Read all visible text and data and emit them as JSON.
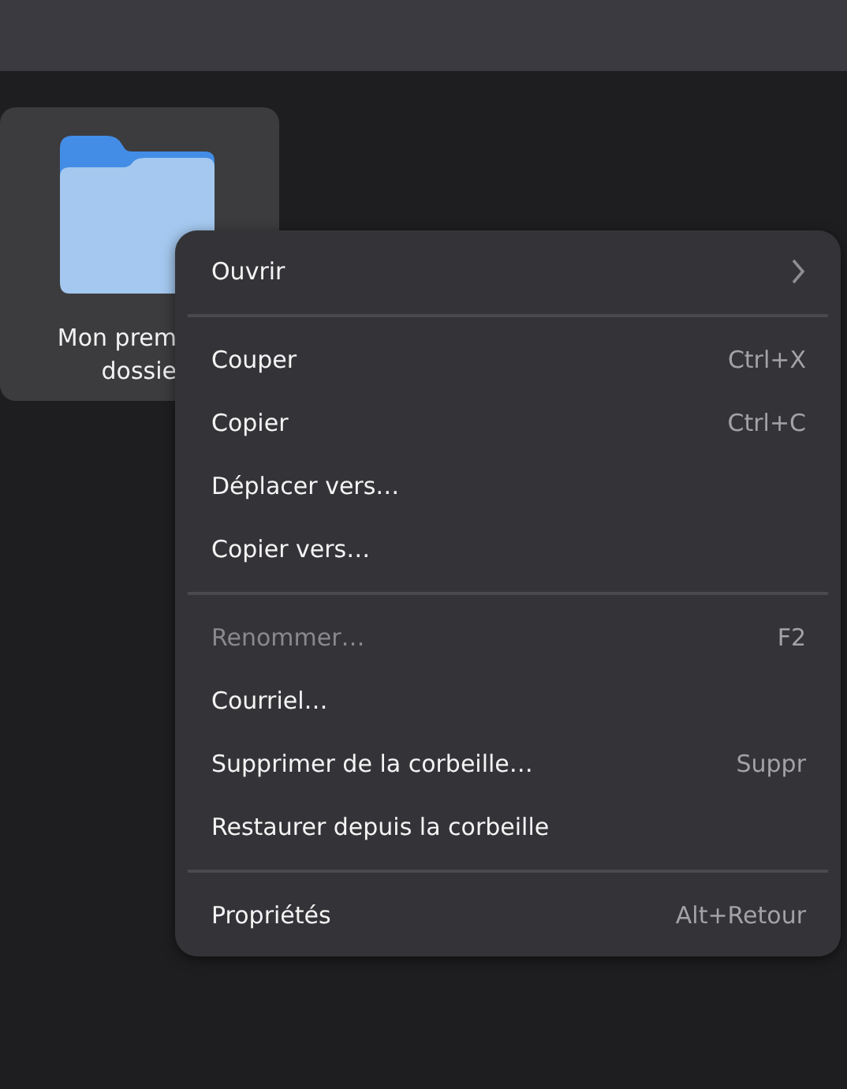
{
  "folder": {
    "label_lines": [
      "Mon prem",
      "dossie"
    ],
    "selected": true
  },
  "context_menu": {
    "sections": [
      [
        {
          "label": "Ouvrir",
          "submenu": true,
          "disabled": false
        }
      ],
      [
        {
          "label": "Couper",
          "shortcut": "Ctrl+X",
          "disabled": false
        },
        {
          "label": "Copier",
          "shortcut": "Ctrl+C",
          "disabled": false
        },
        {
          "label": "Déplacer vers…",
          "disabled": false
        },
        {
          "label": "Copier vers…",
          "disabled": false
        }
      ],
      [
        {
          "label": "Renommer…",
          "shortcut": "F2",
          "disabled": true
        },
        {
          "label": "Courriel…",
          "disabled": false
        },
        {
          "label": "Supprimer de la corbeille…",
          "shortcut": "Suppr",
          "disabled": false
        },
        {
          "label": "Restaurer depuis la corbeille",
          "disabled": false
        }
      ],
      [
        {
          "label": "Propriétés",
          "shortcut": "Alt+Retour",
          "disabled": false
        }
      ]
    ]
  }
}
